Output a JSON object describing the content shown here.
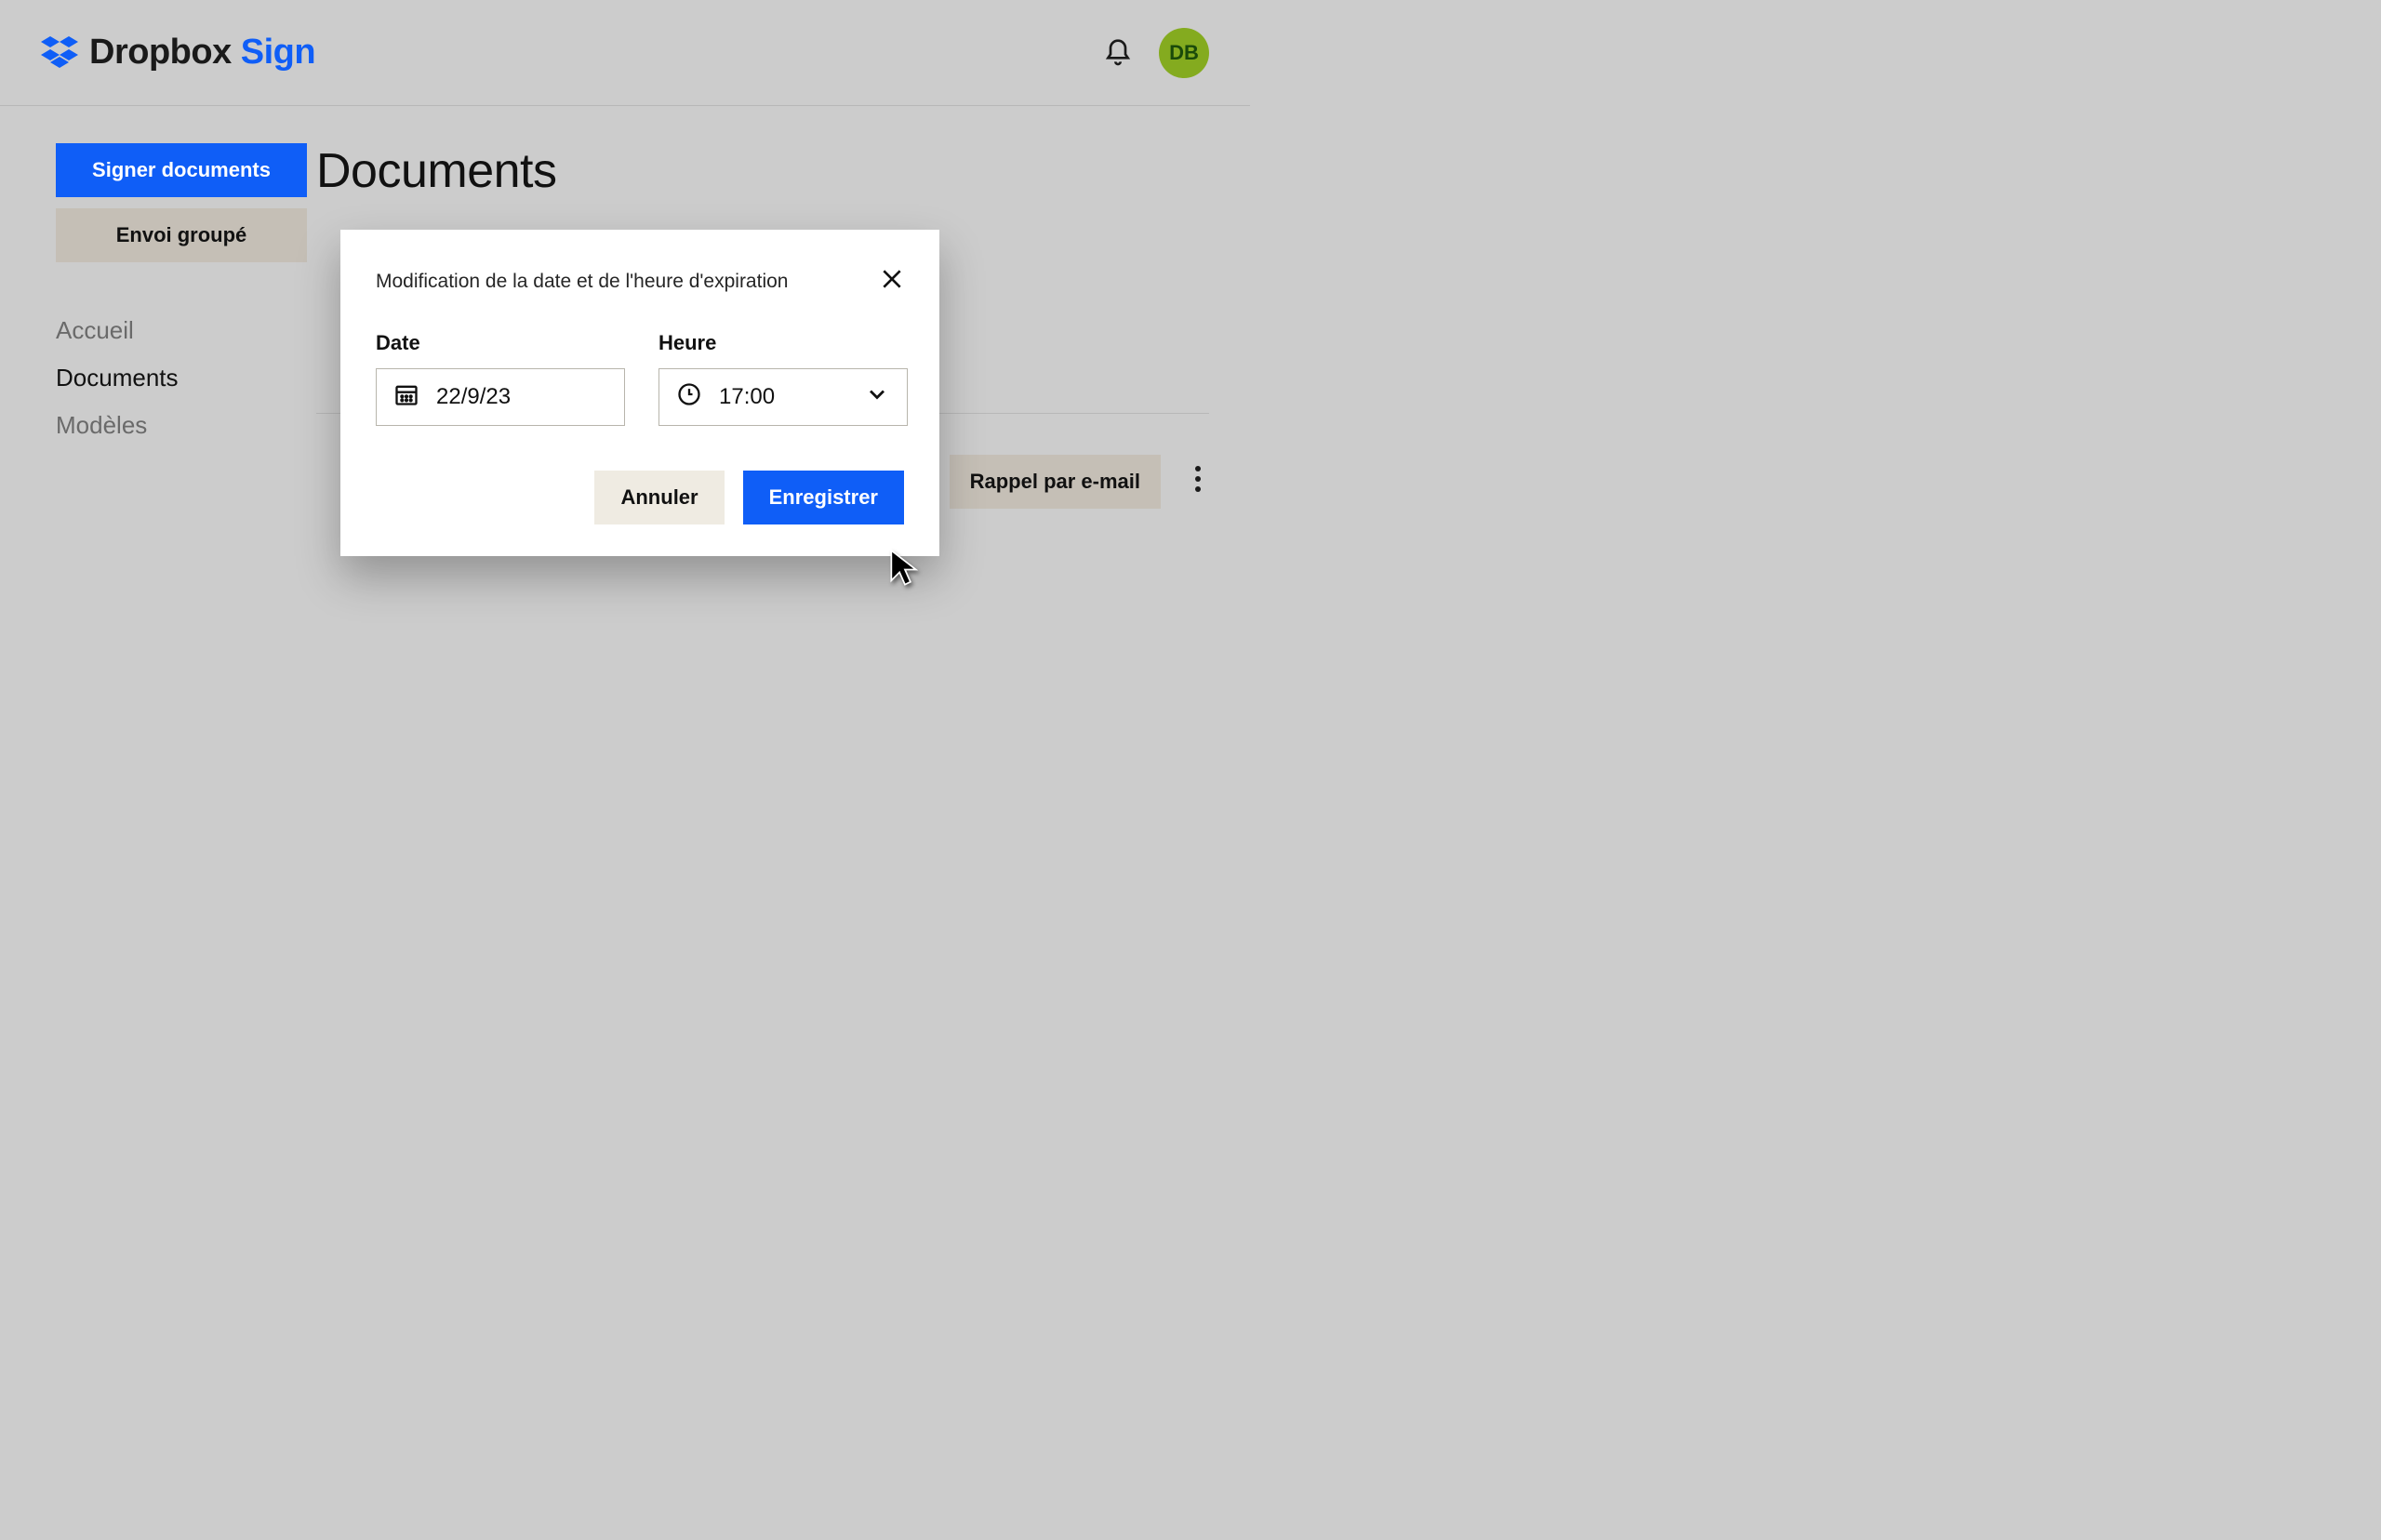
{
  "brand": {
    "name": "Dropbox",
    "product": "Sign"
  },
  "avatar": {
    "initials": "DB"
  },
  "sidebar": {
    "sign_label": "Signer documents",
    "bulk_label": "Envoi groupé",
    "nav": {
      "home": "Accueil",
      "documents": "Documents",
      "templates": "Modèles"
    }
  },
  "main": {
    "title": "Documents",
    "reminder_label": "Rappel par e-mail"
  },
  "modal": {
    "title": "Modification de la date et de l'heure d'expiration",
    "date_label": "Date",
    "date_value": "22/9/23",
    "time_label": "Heure",
    "time_value": "17:00",
    "cancel": "Annuler",
    "save": "Enregistrer"
  }
}
